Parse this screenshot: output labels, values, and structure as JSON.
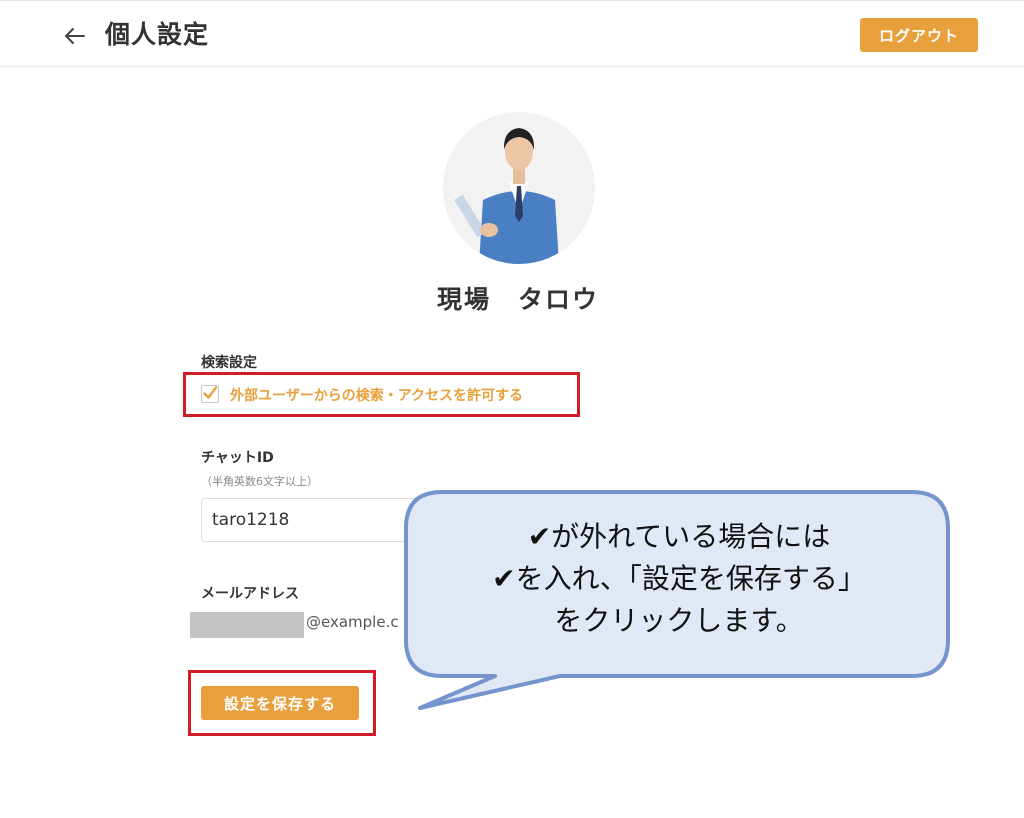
{
  "header": {
    "title": "個人設定",
    "back_icon": "arrow-left-icon",
    "logout_label": "ログアウト"
  },
  "profile": {
    "avatar_icon": "user-photo",
    "name": "現場　タロウ"
  },
  "search_settings": {
    "section_label": "検索設定",
    "checkbox_checked": true,
    "checkbox_label": "外部ユーザーからの検索・アクセスを許可する"
  },
  "chat": {
    "label": "チャットID",
    "hint": "（半角英数6文字以上）",
    "value": "taro1218"
  },
  "email": {
    "label": "メールアドレス",
    "visible_part": "@example.c"
  },
  "save_label": "設定を保存する",
  "callout": {
    "lines": [
      "✔が外れている場合には",
      "✔を入れ、「設定を保存する」",
      "をクリックします。"
    ]
  },
  "colors": {
    "accent": "#e8a03c",
    "highlight": "#d11b25",
    "callout_fill": "#e1e8f5",
    "callout_border": "#7593cd"
  }
}
